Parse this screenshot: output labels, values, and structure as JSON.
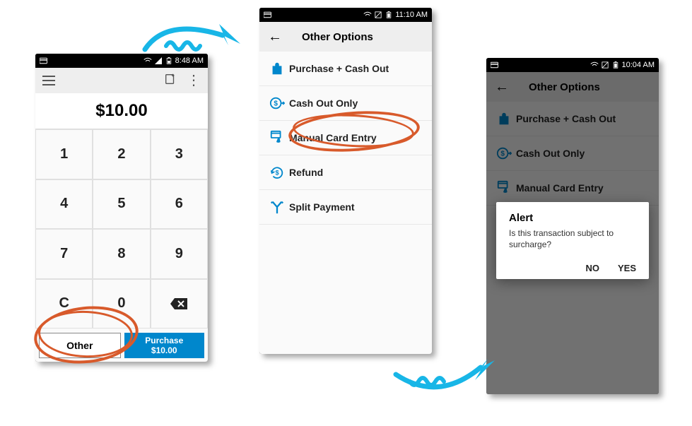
{
  "phone1": {
    "status_time": "8:48 AM",
    "amount": "$10.00",
    "keys": [
      "1",
      "2",
      "3",
      "4",
      "5",
      "6",
      "7",
      "8",
      "9",
      "C",
      "0",
      "⌫"
    ],
    "other_label": "Other",
    "purchase_label": "Purchase",
    "purchase_amount": "$10.00"
  },
  "phone2": {
    "status_time": "11:10 AM",
    "title": "Other Options",
    "options": [
      "Purchase + Cash Out",
      "Cash Out Only",
      "Manual Card Entry",
      "Refund",
      "Split Payment"
    ]
  },
  "phone3": {
    "status_time": "10:04 AM",
    "title": "Other Options",
    "options": [
      "Purchase + Cash Out",
      "Cash Out Only",
      "Manual Card Entry"
    ],
    "dialog": {
      "title": "Alert",
      "message": "Is this transaction subject to surcharge?",
      "no": "NO",
      "yes": "YES"
    }
  },
  "colors": {
    "accent": "#0087cc",
    "scribble": "#d85a2b",
    "arrow": "#18b6e7"
  }
}
